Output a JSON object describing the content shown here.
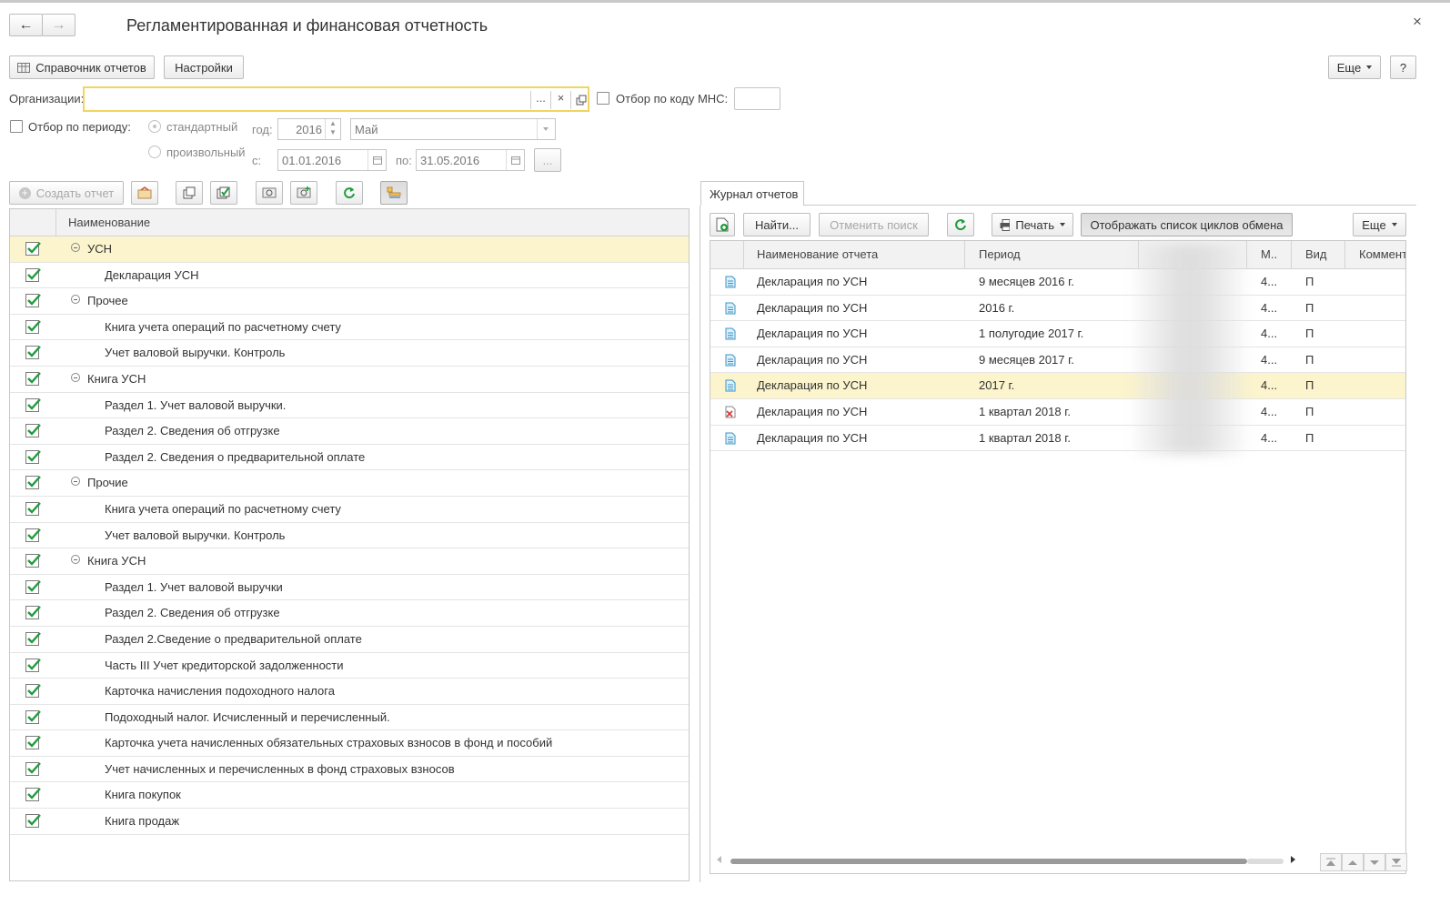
{
  "window": {
    "title": "Регламентированная и финансовая отчетность",
    "close_glyph": "×"
  },
  "toolbar": {
    "back_glyph": "←",
    "forward_glyph": "→",
    "reports_ref_label": "Справочник отчетов",
    "settings_label": "Настройки",
    "more_label": "Еще",
    "help_label": "?"
  },
  "filters": {
    "org_label": "Организации:",
    "org_value": "",
    "org_select_glyph": "...",
    "org_clear_glyph": "×",
    "mns_label": "Отбор по коду МНС:",
    "mns_value": "",
    "period_label": "Отбор по периоду:",
    "standard_label": "стандартный",
    "custom_label": "произвольный",
    "year_label": "год:",
    "year_value": "2016",
    "month_value": "Май",
    "from_label": "с:",
    "from_value": "01.01.2016",
    "to_label": "по:",
    "to_value": "31.05.2016",
    "more_glyph": "..."
  },
  "left_toolbar": {
    "create_report_label": "Создать отчет"
  },
  "tree": {
    "header": "Наименование",
    "rows": [
      {
        "label": "УСН",
        "kind": "group",
        "selected": true
      },
      {
        "label": "Декларация УСН",
        "kind": "item"
      },
      {
        "label": "Прочее",
        "kind": "group"
      },
      {
        "label": "Книга учета операций по расчетному счету",
        "kind": "item"
      },
      {
        "label": "Учет валовой выручки. Контроль",
        "kind": "item"
      },
      {
        "label": "Книга УСН",
        "kind": "group"
      },
      {
        "label": "Раздел 1. Учет валовой выручки.",
        "kind": "item"
      },
      {
        "label": "Раздел 2. Сведения об отгрузке",
        "kind": "item"
      },
      {
        "label": "Раздел 2. Сведения о предварительной оплате",
        "kind": "item"
      },
      {
        "label": "Прочие",
        "kind": "group"
      },
      {
        "label": "Книга учета операций по расчетному счету",
        "kind": "item"
      },
      {
        "label": "Учет валовой выручки. Контроль",
        "kind": "item"
      },
      {
        "label": "Книга УСН",
        "kind": "group"
      },
      {
        "label": "Раздел 1. Учет валовой выручки",
        "kind": "item"
      },
      {
        "label": "Раздел 2. Сведения об отгрузке",
        "kind": "item"
      },
      {
        "label": "Раздел 2.Сведение о предварительной оплате",
        "kind": "item"
      },
      {
        "label": "Часть  III   Учет кредиторской задолженности",
        "kind": "item"
      },
      {
        "label": "Карточка начисления подоходного налога",
        "kind": "item"
      },
      {
        "label": "Подоходный налог. Исчисленный и перечисленный.",
        "kind": "item"
      },
      {
        "label": "Карточка учета начисленных обязательных страховых взносов в фонд и пособий",
        "kind": "item"
      },
      {
        "label": "Учет начисленных и перечисленных в фонд страховых взносов",
        "kind": "item"
      },
      {
        "label": "Книга покупок",
        "kind": "item"
      },
      {
        "label": "Книга продаж",
        "kind": "item"
      }
    ]
  },
  "journal": {
    "tab_label": "Журнал отчетов",
    "find_label": "Найти...",
    "cancel_search_label": "Отменить поиск",
    "print_label": "Печать",
    "show_cycles_label": "Отображать список циклов обмена",
    "more_label": "Еще",
    "columns": [
      "Наименование отчета",
      "Период",
      "М..",
      "Вид",
      "Коммент"
    ],
    "rows": [
      {
        "name": "Декларация по УСН",
        "period": "9 месяцев 2016 г.",
        "m": "4...",
        "kind": "П",
        "status": "ok"
      },
      {
        "name": "Декларация по УСН",
        "period": "2016 г.",
        "m": "4...",
        "kind": "П",
        "status": "ok"
      },
      {
        "name": "Декларация по УСН",
        "period": "1 полугодие 2017 г.",
        "m": "4...",
        "kind": "П",
        "status": "ok"
      },
      {
        "name": "Декларация по УСН",
        "period": "9 месяцев 2017 г.",
        "m": "4...",
        "kind": "П",
        "status": "ok"
      },
      {
        "name": "Декларация по УСН",
        "period": "2017 г.",
        "m": "4...",
        "kind": "П",
        "status": "ok",
        "selected": true
      },
      {
        "name": "Декларация по УСН",
        "period": "1 квартал 2018 г.",
        "m": "4...",
        "kind": "П",
        "status": "error"
      },
      {
        "name": "Декларация по УСН",
        "period": "1 квартал 2018 г.",
        "m": "4...",
        "kind": "П",
        "status": "ok"
      }
    ]
  },
  "colors": {
    "accent_yellow": "#f0d560",
    "selection": "#fbf4cc",
    "check_green": "#1f9c3c",
    "doc_blue": "#3b95c8",
    "error_red": "#d33"
  }
}
